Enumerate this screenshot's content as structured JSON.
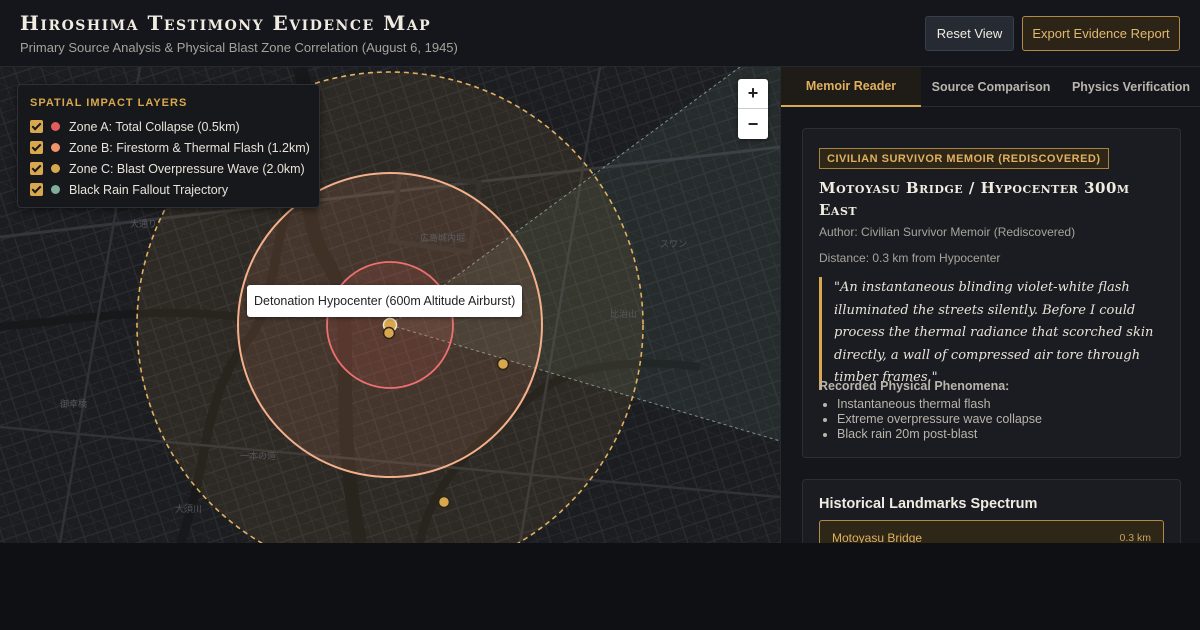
{
  "header": {
    "title": "Hiroshima Testimony Evidence Map",
    "subtitle": "Primary Source Analysis & Physical Blast Zone Correlation (August 6, 1945)",
    "reset_label": "Reset View",
    "export_label": "Export Evidence Report"
  },
  "map": {
    "layers_title": "SPATIAL IMPACT LAYERS",
    "layers": [
      {
        "label": "Zone A: Total Collapse (0.5km)",
        "color": "#e25c5c",
        "checked": true
      },
      {
        "label": "Zone B: Firestorm & Thermal Flash (1.2km)",
        "color": "#f0946a",
        "checked": true
      },
      {
        "label": "Zone C: Blast Overpressure Wave (2.0km)",
        "color": "#d9a84e",
        "checked": true
      },
      {
        "label": "Black Rain Fallout Trajectory",
        "color": "#7fae9a",
        "checked": true
      }
    ],
    "zoom_in": "+",
    "zoom_out": "−",
    "tooltip": "Detonation Hypocenter (600m Altitude Airburst)",
    "labels": [
      "広島城内堀",
      "大須川",
      "一本の道",
      "比治山",
      "御幸橋",
      "大通り",
      "スワン"
    ]
  },
  "tabs": [
    {
      "label": "Memoir Reader",
      "active": true
    },
    {
      "label": "Source Comparison",
      "active": false
    },
    {
      "label": "Physics Verification",
      "active": false
    }
  ],
  "memoir": {
    "badge": "CIVILIAN SURVIVOR MEMOIR (REDISCOVERED)",
    "title": "Motoyasu Bridge / Hypocenter 300m East",
    "author": "Author: Civilian Survivor Memoir (Rediscovered)",
    "distance": "Distance: 0.3 km from Hypocenter",
    "quote": "\"An instantaneous blinding violet-white flash illuminated the streets silently. Before I could process the thermal radiance that scorched skin directly, a wall of compressed air tore through timber frames.\"",
    "phenomena_title": "Recorded Physical Phenomena:",
    "phenomena": [
      "Instantaneous thermal flash",
      "Extreme overpressure wave collapse",
      "Black rain 20m post-blast"
    ]
  },
  "landmarks": {
    "title": "Historical Landmarks Spectrum",
    "items": [
      {
        "name": "Motoyasu Bridge",
        "distance": "0.3 km"
      }
    ]
  }
}
